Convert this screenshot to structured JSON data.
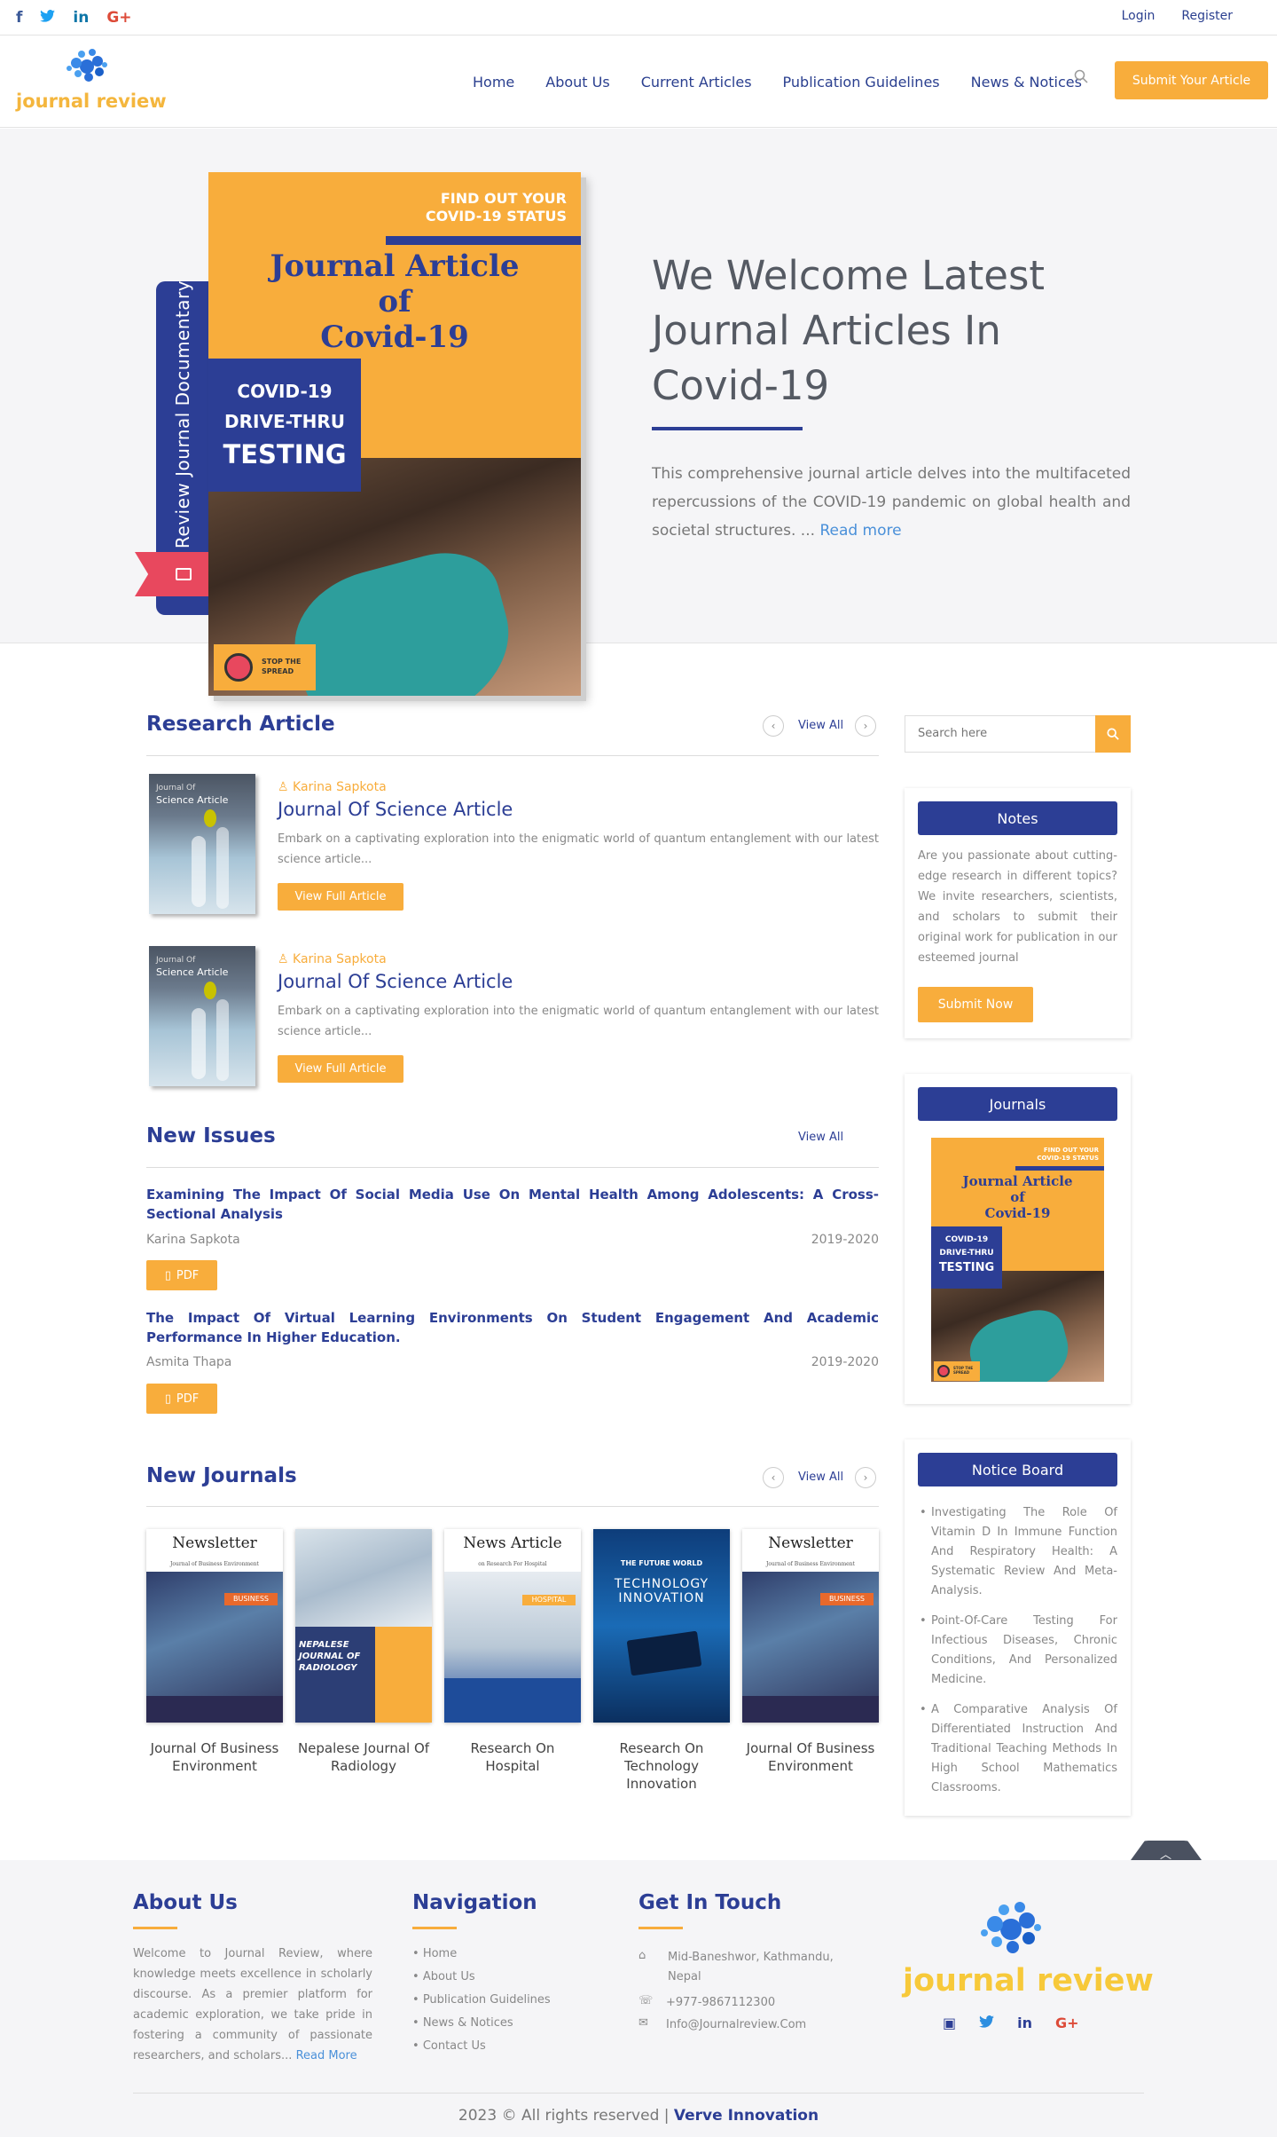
{
  "topbar": {
    "social": [
      "f",
      "t",
      "in",
      "G+"
    ],
    "login": "Login",
    "register": "Register"
  },
  "header": {
    "logo_text": "journal review",
    "nav": [
      "Home",
      "About Us",
      "Current Articles",
      "Publication Guidelines",
      "News & Notices"
    ],
    "submit_button": "Submit Your Article"
  },
  "hero": {
    "ribbon_text": "Review Journal Documentary",
    "book": {
      "find_out": "FIND OUT YOUR",
      "covid_status": "COVID-19 STATUS",
      "title_line1": "Journal Article",
      "title_line2": "of",
      "title_line3": "Covid-19",
      "blue_line1": "COVID-19",
      "blue_line2": "DRIVE-THRU",
      "blue_line3": "TESTING",
      "stop_line1": "STOP THE",
      "stop_line2": "SPREAD"
    },
    "title": "We Welcome Latest Journal Articles In Covid-19",
    "text": "This comprehensive journal article delves into the multifaceted repercussions of the COVID-19 pandemic on global health and societal structures. ...",
    "read_more": "Read more"
  },
  "research": {
    "title": "Research Article",
    "view_all": "View All",
    "items": [
      {
        "thumb_small": "Journal Of",
        "thumb_big": "Science Article",
        "author": "Karina Sapkota",
        "title": "Journal Of Science Article",
        "desc": "Embark on a captivating exploration into the enigmatic world of quantum entanglement with our latest science article...",
        "button": "View Full Article"
      },
      {
        "thumb_small": "Journal Of",
        "thumb_big": "Science Article",
        "author": "Karina Sapkota",
        "title": "Journal Of Science Article",
        "desc": "Embark on a captivating exploration into the enigmatic world of quantum entanglement with our latest science article...",
        "button": "View Full Article"
      }
    ]
  },
  "issues": {
    "title": "New Issues",
    "view_all": "View All",
    "items": [
      {
        "title": "Examining The Impact Of Social Media Use On Mental Health Among Adolescents: A Cross-Sectional Analysis",
        "author": "Karina Sapkota",
        "year": "2019-2020",
        "button": "PDF"
      },
      {
        "title": "The Impact Of Virtual Learning Environments On Student Engagement And Academic Performance In Higher Education.",
        "author": "Asmita Thapa",
        "year": "2019-2020",
        "button": "PDF"
      }
    ]
  },
  "journals": {
    "title": "New Journals",
    "view_all": "View All",
    "items": [
      {
        "name": "Journal Of Business Environment",
        "cover_head": "Newsletter",
        "cover_sub": "Journal of Business Environment",
        "cover_tag": "BUSINESS"
      },
      {
        "name": "Nepalese Journal Of Radiology",
        "cover_head": "",
        "cover_sub": "",
        "cover_tag": "NEPALESE JOURNAL OF RADIOLOGY"
      },
      {
        "name": "Research On Hospital",
        "cover_head": "News Article",
        "cover_sub": "on Research For Hospital",
        "cover_tag": "HOSPITAL"
      },
      {
        "name": "Research On Technology Innovation",
        "cover_head": "THE FUTURE WORLD",
        "cover_sub": "",
        "cover_tag": "TECHNOLOGY INNOVATION"
      },
      {
        "name": "Journal Of Business Environment",
        "cover_head": "Newsletter",
        "cover_sub": "Journal of Business Environment",
        "cover_tag": "BUSINESS"
      }
    ]
  },
  "sidebar": {
    "search_placeholder": "Search here",
    "notes": {
      "title": "Notes",
      "text": "Are you passionate about cutting-edge research in different topics? We invite researchers, scientists, and scholars to submit their original work for publication in our esteemed journal",
      "button": "Submit Now"
    },
    "journals": {
      "title": "Journals"
    },
    "notice_board": {
      "title": "Notice Board",
      "items": [
        "Investigating The Role Of Vitamin D In Immune Function And Respiratory Health: A Systematic Review And Meta-Analysis.",
        "Point-Of-Care Testing For Infectious Diseases, Chronic Conditions, And Personalized Medicine.",
        "A Comparative Analysis Of Differentiated Instruction And Traditional Teaching Methods In High School Mathematics Classrooms."
      ]
    }
  },
  "footer": {
    "about": {
      "title": "About Us",
      "text": "Welcome to Journal Review, where knowledge meets excellence in scholarly discourse. As a premier platform for academic exploration, we take pride in fostering a community of passionate researchers, and scholars...",
      "read_more": "Read More"
    },
    "navigation": {
      "title": "Navigation",
      "items": [
        "Home",
        "About Us",
        "Publication Guidelines",
        "News & Notices",
        "Contact Us"
      ]
    },
    "contact": {
      "title": "Get In Touch",
      "address": "Mid-Baneshwor, Kathmandu, Nepal",
      "phone": "+977-9867112300",
      "email": "Info@Journalreview.Com"
    },
    "logo_text": "journal review",
    "copyright": "2023 © All rights reserved |",
    "company": "Verve Innovation"
  },
  "colors": {
    "primary": "#2c3e95",
    "accent": "#f8ad3c",
    "ribbon_tag": "#e8485e"
  }
}
